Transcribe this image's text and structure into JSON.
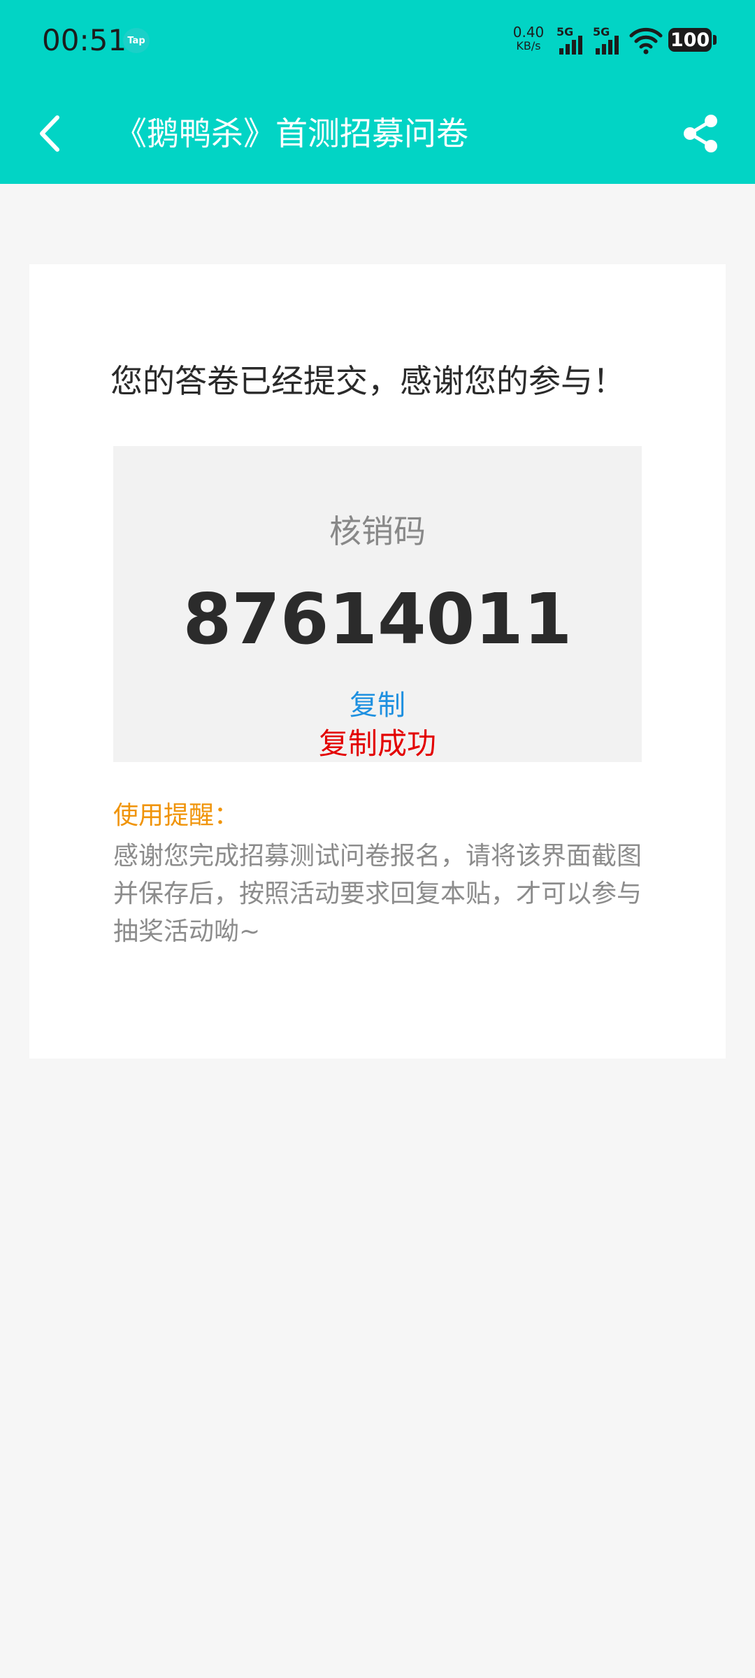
{
  "status_bar": {
    "time": "00:51",
    "app_badge": "Tap",
    "net_speed_value": "0.40",
    "net_speed_unit": "KB/s",
    "sim1_network": "5G",
    "sim2_network": "5G",
    "battery": "100"
  },
  "header": {
    "title": "《鹅鸭杀》首测招募问卷",
    "back_icon": "chevron-left-icon",
    "share_icon": "share-icon"
  },
  "result": {
    "message": "您的答卷已经提交，感谢您的参与！",
    "code_label": "核销码",
    "code_value": "87614011",
    "copy_label": "复制",
    "copy_status": "复制成功",
    "reminder_title": "使用提醒：",
    "reminder_text": "感谢您完成招募测试问卷报名，请将该界面截图并保存后，按照活动要求回复本贴，才可以参与抽奖活动呦~"
  },
  "colors": {
    "header_bg": "#02d4c5",
    "page_bg": "#f6f6f6",
    "copy_link": "#1e90e0",
    "copy_success": "#e30000",
    "reminder_title": "#f0940a"
  }
}
